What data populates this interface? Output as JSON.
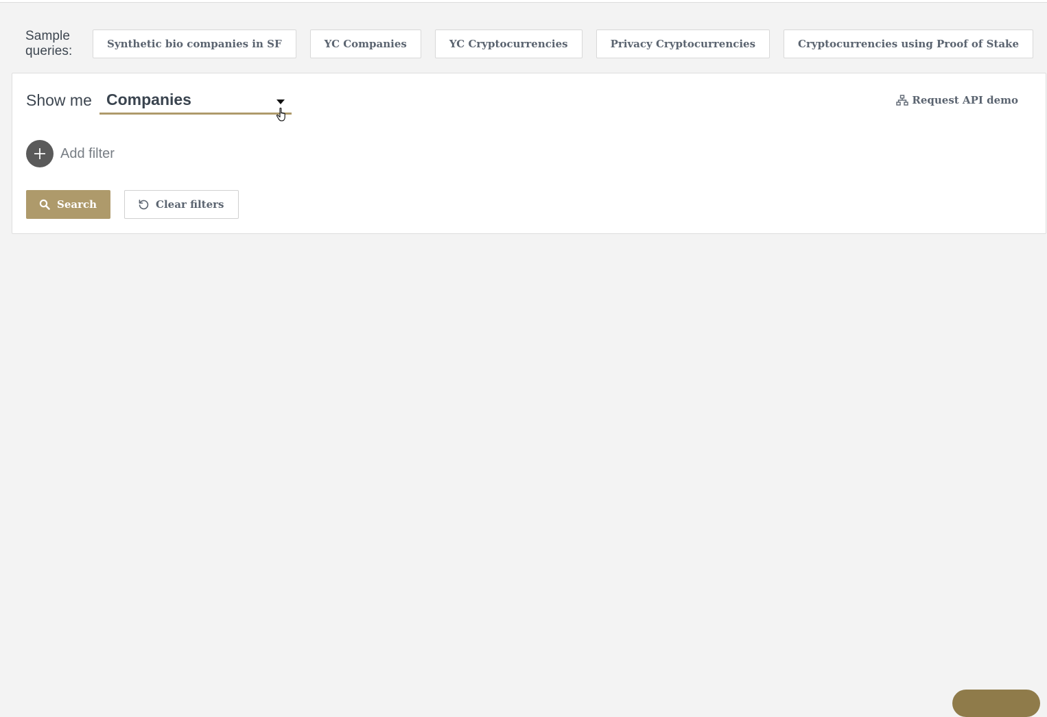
{
  "sample_queries": {
    "label": "Sample queries:",
    "items": [
      "Synthetic bio companies in SF",
      "YC Companies",
      "YC Cryptocurrencies",
      "Privacy Cryptocurrencies",
      "Cryptocurrencies using Proof of Stake"
    ]
  },
  "query_panel": {
    "show_me_label": "Show me",
    "entity_select": {
      "selected": "Companies"
    },
    "api_demo_label": "Request API demo",
    "add_filter_label": "Add filter",
    "search_button": "Search",
    "clear_button": "Clear filters"
  },
  "icons": {
    "api": "sitemap-icon",
    "add": "plus-circle-icon",
    "search": "search-icon",
    "clear": "undo-icon",
    "dropdown": "caret-down-icon"
  },
  "colors": {
    "accent": "#ae9a6b",
    "background": "#f3f3f3",
    "text": "#3d4650",
    "add_filter_circle": "#5a5a5a"
  }
}
